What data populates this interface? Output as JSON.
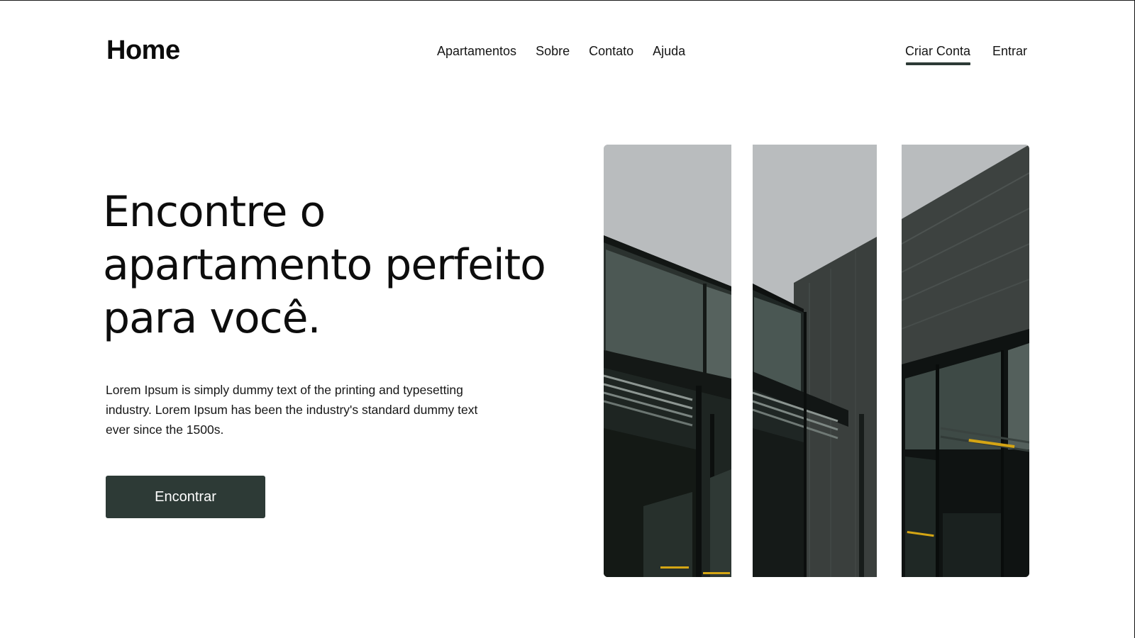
{
  "brand": {
    "logo": "Home"
  },
  "nav": {
    "links": [
      "Apartamentos",
      "Sobre",
      "Contato",
      "Ajuda"
    ],
    "signup_label": "Criar Conta",
    "login_label": "Entrar"
  },
  "hero": {
    "title": "Encontre o apartamento perfeito para você.",
    "description": "Lorem Ipsum is simply dummy text of the printing and typesetting industry. Lorem Ipsum has been the industry's standard dummy text ever since the 1500s.",
    "button_label": "Encontrar"
  },
  "colors": {
    "accent": "#2d3a36",
    "sky": "#b9bcbe",
    "building_dark": "#1b201e",
    "highlight": "#d4a514"
  },
  "images": {
    "panel_count": 3,
    "subject": "modern building facade"
  }
}
